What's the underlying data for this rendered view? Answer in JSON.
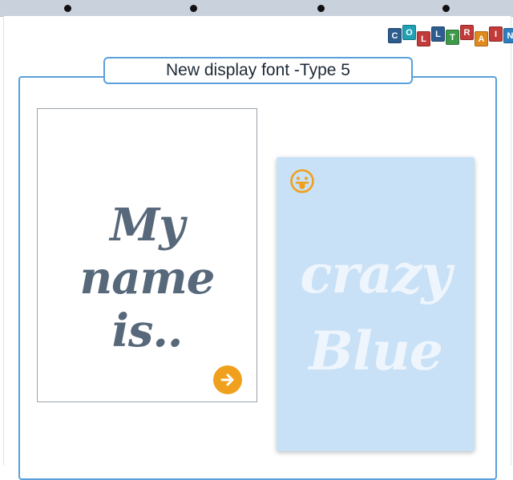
{
  "title": "New display font -Type 5",
  "logo": {
    "letters": [
      "C",
      "O",
      "L",
      "L",
      "T",
      "R",
      "A",
      "I",
      "N"
    ],
    "colors": [
      "#2d5d8f",
      "#1fa0b3",
      "#c23a3a",
      "#2d5d8f",
      "#3e9a4a",
      "#c23a3a",
      "#e08a1e",
      "#c23a3a",
      "#2d7fc0"
    ]
  },
  "left_card": {
    "line1": "My name",
    "line2": "is..",
    "next_icon": "arrow-right-circle-icon"
  },
  "right_card": {
    "line1": "crazy",
    "line2": "Blue",
    "emoji_icon": "tongue-out-face-icon"
  },
  "colors": {
    "accent_border": "#5aa0db",
    "left_text": "#56687a",
    "right_card_bg": "#c8e1f7",
    "arrow_button": "#f0a01c"
  }
}
